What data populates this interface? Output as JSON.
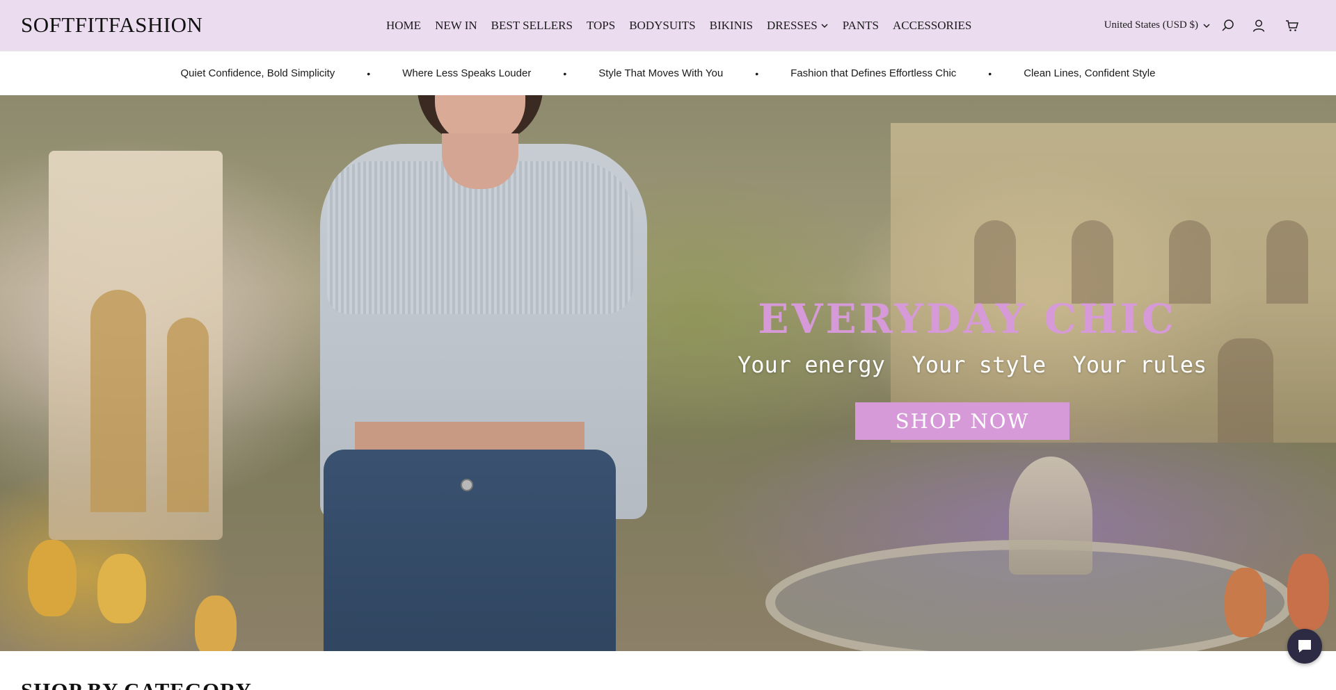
{
  "header": {
    "logo": "SOFTFITFASHION",
    "nav": [
      {
        "label": "HOME"
      },
      {
        "label": "NEW IN"
      },
      {
        "label": "BEST SELLERS"
      },
      {
        "label": "TOPS"
      },
      {
        "label": "BODYSUITS"
      },
      {
        "label": "BIKINIS"
      },
      {
        "label": "DRESSES",
        "has_dropdown": true
      },
      {
        "label": "PANTS"
      },
      {
        "label": "ACCESSORIES"
      }
    ],
    "currency": "United States (USD $)",
    "icons": [
      "search-icon",
      "account-icon",
      "cart-icon"
    ]
  },
  "announcement": {
    "items": [
      "Quiet Confidence, Bold Simplicity",
      "Where Less Speaks Louder",
      "Style That Moves With You",
      "Fashion that Defines Effortless Chic",
      "Clean Lines, Confident Style"
    ],
    "separator": "•"
  },
  "hero": {
    "title": "EVERYDAY CHIC",
    "subtitle": "Your energy  Your style  Your rules",
    "button_label": "SHOP NOW",
    "accent_color": "#d79ad8"
  },
  "section": {
    "title": "SHOP BY CATEGORY"
  },
  "chat": {
    "icon": "chat-icon"
  },
  "colors": {
    "header_bg": "#ecdcf0",
    "accent": "#d79ad8",
    "chat_bg": "#2d2b44"
  }
}
